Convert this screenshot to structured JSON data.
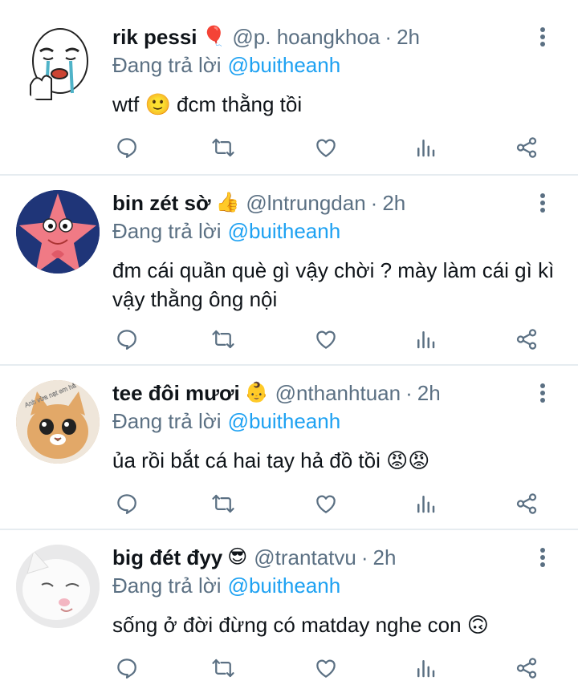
{
  "tweets": [
    {
      "display_name": "rik pessi",
      "badge_emoji": "🎈",
      "handle": "@p. hoangkhoa",
      "time": "2h",
      "replying_label": "Đang trả lời",
      "replying_to": "@buitheanh",
      "text": "wtf 🙂 đcm thằng tồi",
      "avatar_icon": "crying-meme-face"
    },
    {
      "display_name": "bin zét sờ",
      "badge_emoji": "👍",
      "handle": "@lntrungdan",
      "time": "2h",
      "replying_label": "Đang trả lời",
      "replying_to": "@buitheanh",
      "text": "đm cái quần què gì vậy chời ? mày làm cái gì kì vậy thằng ông nội",
      "avatar_icon": "patrick-star"
    },
    {
      "display_name": "tee đôi mươi",
      "badge_emoji": "👶",
      "handle": "@nthanhtuan",
      "time": "2h",
      "replying_label": "Đang trả lời",
      "replying_to": "@buitheanh",
      "text": "ủa rồi bắt cá hai tay hả đồ tồi 😡😡",
      "avatar_icon": "cat-photo",
      "avatar_caption": "Anh vừa nạt em hả"
    },
    {
      "display_name": "big đét đyy",
      "badge_emoji": "😎",
      "handle": "@trantatvu",
      "time": "2h",
      "replying_label": "Đang trả lời",
      "replying_to": "@buitheanh",
      "text": "sống ở đời đừng có matday nghe con 🙃",
      "avatar_icon": "white-cat-photo"
    }
  ],
  "separator": "·",
  "action_icons": [
    "reply-icon",
    "retweet-icon",
    "like-icon",
    "analytics-icon",
    "share-icon"
  ],
  "colors": {
    "text": "#0f1419",
    "secondary": "#5b7083",
    "mention": "#1da1f2",
    "divider": "#e6ecf0"
  }
}
